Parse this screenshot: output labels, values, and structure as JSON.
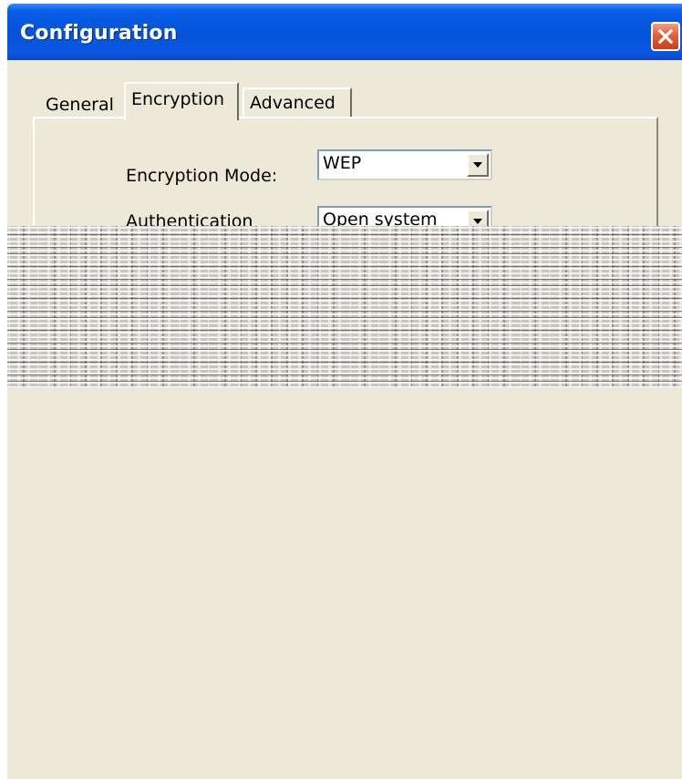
{
  "window": {
    "title": "Configuration",
    "close_icon": "close-icon"
  },
  "tabs": [
    {
      "label": "General"
    },
    {
      "label": "Encryption"
    },
    {
      "label": "Advanced"
    }
  ],
  "encryption": {
    "mode_label": "Encryption Mode:",
    "mode_value": "WEP",
    "auth_label": "Authentication",
    "auth_value": "Open system"
  },
  "colors": {
    "titlebar": "#0453D8",
    "close_button": "#E0603C",
    "dialog_background": "#ECE9D8"
  }
}
